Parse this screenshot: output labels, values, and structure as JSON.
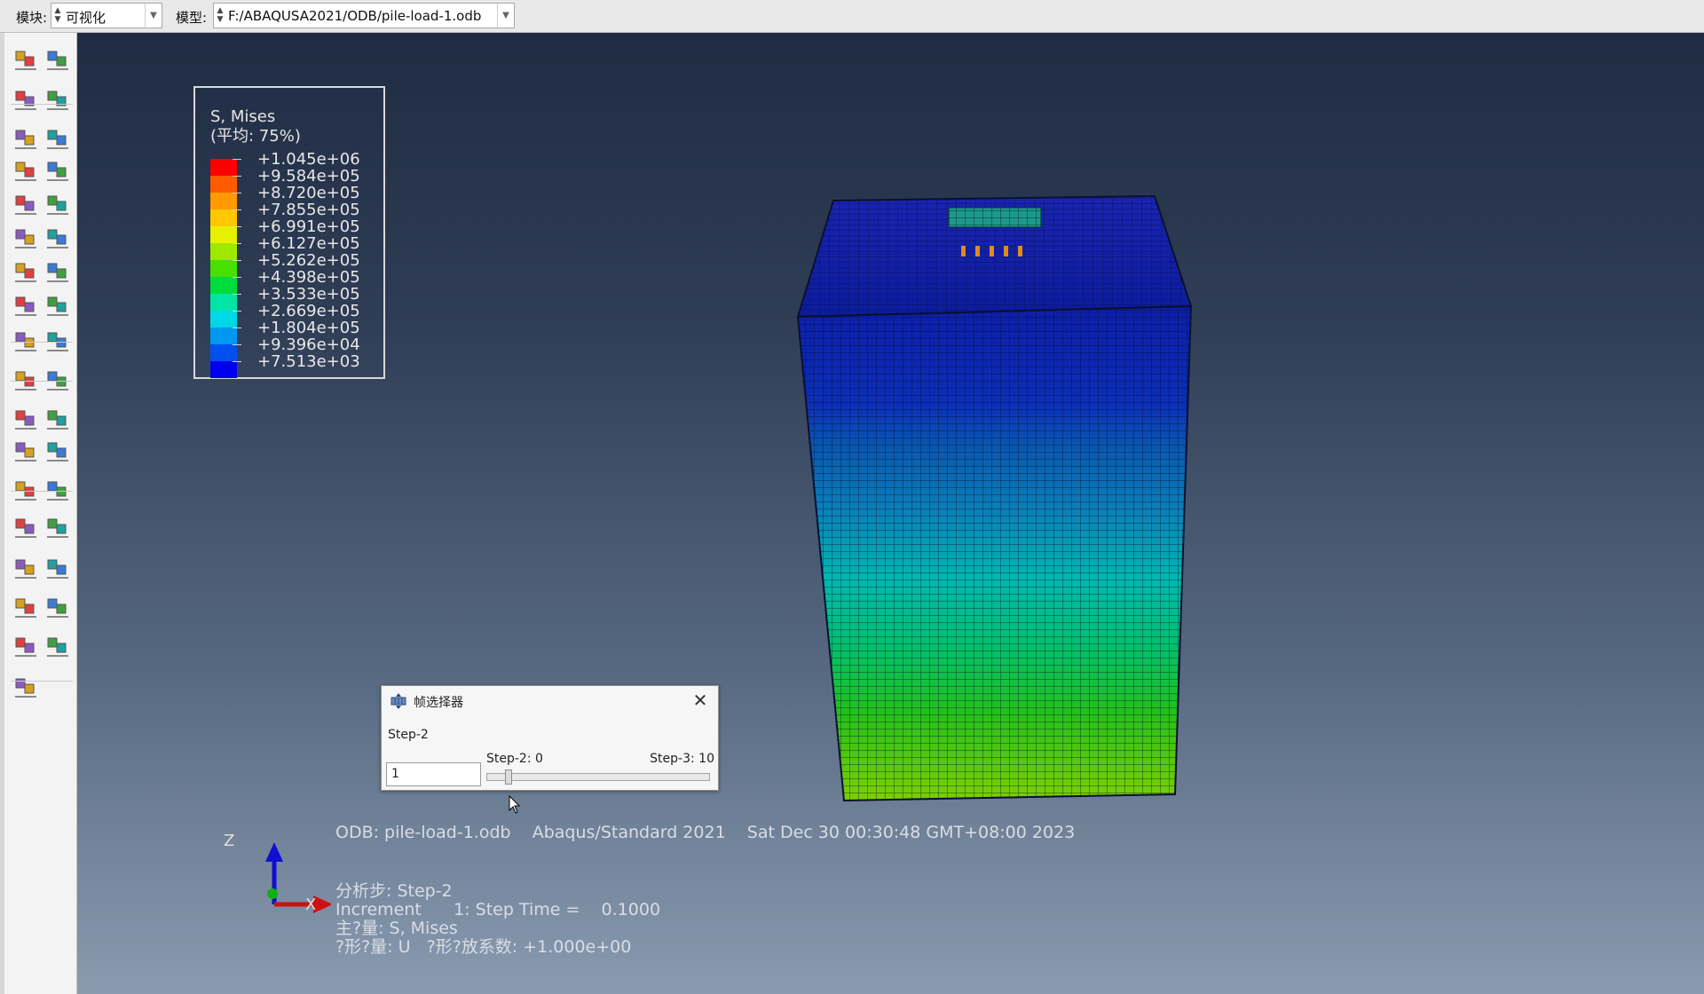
{
  "topbar": {
    "module_label": "模块:",
    "module_value": "可视化",
    "model_label": "模型:",
    "model_value": "F:/ABAQUSA2021/ODB/pile-load-1.odb"
  },
  "toolbox": {
    "tools": [
      "plot-undeformed-icon",
      "plot-deformed-icon",
      "plot-contours-icon",
      "plot-symbols-icon",
      "plot-material-orientations-icon",
      "allow-multiple-plots-icon",
      "contour-options-icon",
      "contour-options-alt-icon",
      "symbol-options-icon",
      "symbol-options-alt-icon",
      "orientation-options-icon",
      "orientation-options-alt-icon",
      "common-options-icon",
      "common-options-alt-icon",
      "animate-scale-factor-icon",
      "animate-time-history-icon",
      "animate-harmonic-icon",
      "animation-options-icon",
      "view-cut-icon",
      "view-cut-manager-icon",
      "create-field-output-icon",
      "field-output-manager-icon",
      "query-distance-icon",
      "xy-plot-icon",
      "display-group-icon",
      "display-group-manager-icon",
      "color-code-icon",
      "color-code-manager-icon",
      "create-path-icon",
      "path-manager-icon",
      "stream-plot-icon",
      "stream-manager-icon",
      "free-body-cut-icon",
      "free-body-manager-icon",
      "query-probe-icon"
    ]
  },
  "legend": {
    "title_line1": "S, Mises",
    "title_line2": "(平均: 75%)",
    "values": [
      "+1.045e+06",
      "+9.584e+05",
      "+8.720e+05",
      "+7.855e+05",
      "+6.991e+05",
      "+6.127e+05",
      "+5.262e+05",
      "+4.398e+05",
      "+3.533e+05",
      "+2.669e+05",
      "+1.804e+05",
      "+9.396e+04",
      "+7.513e+03"
    ],
    "colors": [
      "#ff0000",
      "#ff5a00",
      "#ff9a00",
      "#ffc800",
      "#e6f000",
      "#a0e800",
      "#48e000",
      "#00dc3c",
      "#00e4a4",
      "#00d8e6",
      "#0098f0",
      "#0050f0",
      "#0000ee"
    ]
  },
  "dialog": {
    "title": "帧选择器",
    "step_name": "Step-2",
    "min_label": "Step-2: 0",
    "max_label": "Step-3: 10",
    "frame_value": "1",
    "slider_fraction": 0.1
  },
  "info": {
    "odb_line": "ODB: pile-load-1.odb    Abaqus/Standard 2021    Sat Dec 30 00:30:48 GMT+08:00 2023",
    "step_line": "分析步: Step-2",
    "increment_line": "Increment      1: Step Time =    0.1000",
    "primary_var_line": "主?量: S, Mises",
    "deformed_var_line": "?形?量: U   ?形?放系数: +1.000e+00"
  },
  "triad": {
    "z_label": "Z",
    "x_label": "X"
  }
}
